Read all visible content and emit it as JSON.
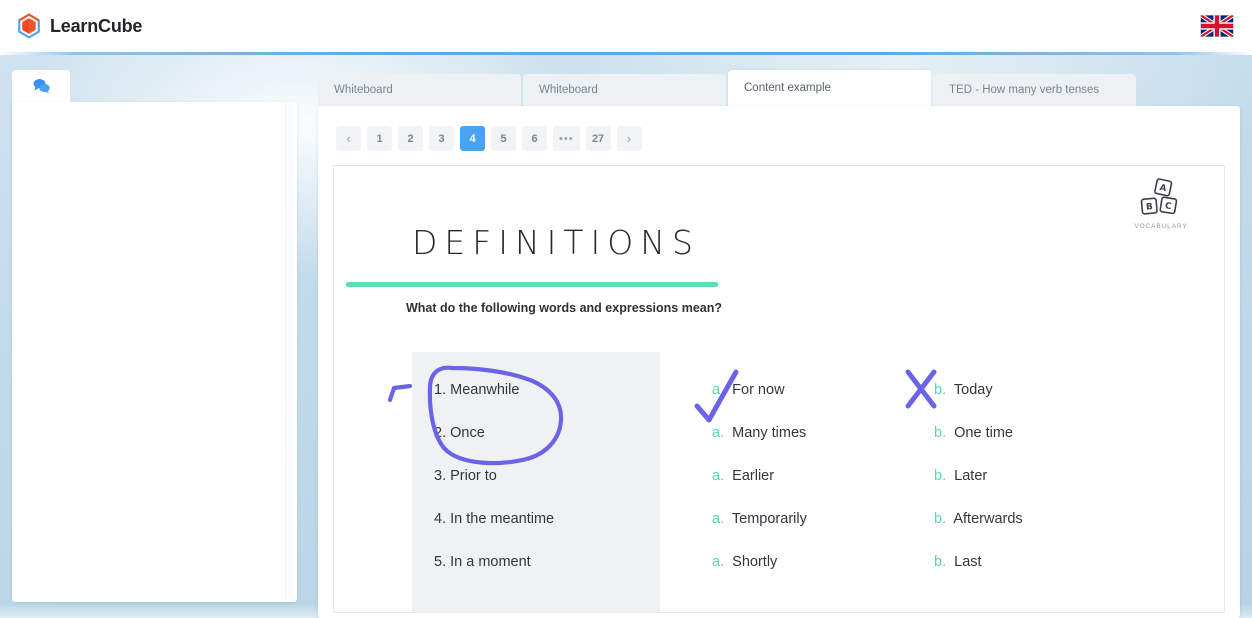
{
  "header": {
    "brand_name": "LearnCube",
    "logo_icon": "learncube-hexagon-logo",
    "language_flag": "uk-flag-icon",
    "language_flag_alt": "English (UK)"
  },
  "chat_panel": {
    "tab_icon": "chat-bubbles-icon",
    "messages": []
  },
  "content": {
    "tabs": [
      {
        "label": "Whiteboard",
        "active": false
      },
      {
        "label": "Whiteboard",
        "active": false
      },
      {
        "label": "Content example",
        "active": true
      },
      {
        "label": "TED - How many verb tenses",
        "active": false
      }
    ],
    "pagination": {
      "prev_label": "‹",
      "next_label": "›",
      "ellipsis": "•••",
      "pages": [
        "1",
        "2",
        "3",
        "4",
        "5",
        "6"
      ],
      "last_page": "27",
      "current_page": "4"
    },
    "slide": {
      "badge_label": "VOCABULARY",
      "badge_icon": "abc-blocks-icon",
      "title": "DEFINITIONS",
      "subtitle": "What do the following words and expressions mean?",
      "questions": [
        "1. Meanwhile",
        "2. Once",
        "3. Prior to",
        "4. In the meantime",
        "5. In a moment"
      ],
      "option_a": [
        {
          "key": "a.",
          "text": "For now"
        },
        {
          "key": "a.",
          "text": "Many times"
        },
        {
          "key": "a.",
          "text": "Earlier"
        },
        {
          "key": "a.",
          "text": "Temporarily"
        },
        {
          "key": "a.",
          "text": "Shortly"
        }
      ],
      "option_b": [
        {
          "key": "b.",
          "text": "Today"
        },
        {
          "key": "b.",
          "text": "One time"
        },
        {
          "key": "b.",
          "text": "Later"
        },
        {
          "key": "b.",
          "text": "Afterwards"
        },
        {
          "key": "b.",
          "text": "Last"
        }
      ],
      "annotations": [
        {
          "name": "circle-around-items-1-2",
          "type": "lasso"
        },
        {
          "name": "check-mark-option-a-for-now",
          "type": "check"
        },
        {
          "name": "cross-mark-option-b-today",
          "type": "cross"
        }
      ]
    }
  },
  "colors": {
    "accent_blue": "#4aa3f0",
    "title_rule_green": "#5fdcb0",
    "option_key_green": "#56d9ae",
    "ink_purple": "#6b63e8",
    "brand_orange": "#f2552c",
    "brand_blue": "#4aa3f0"
  }
}
